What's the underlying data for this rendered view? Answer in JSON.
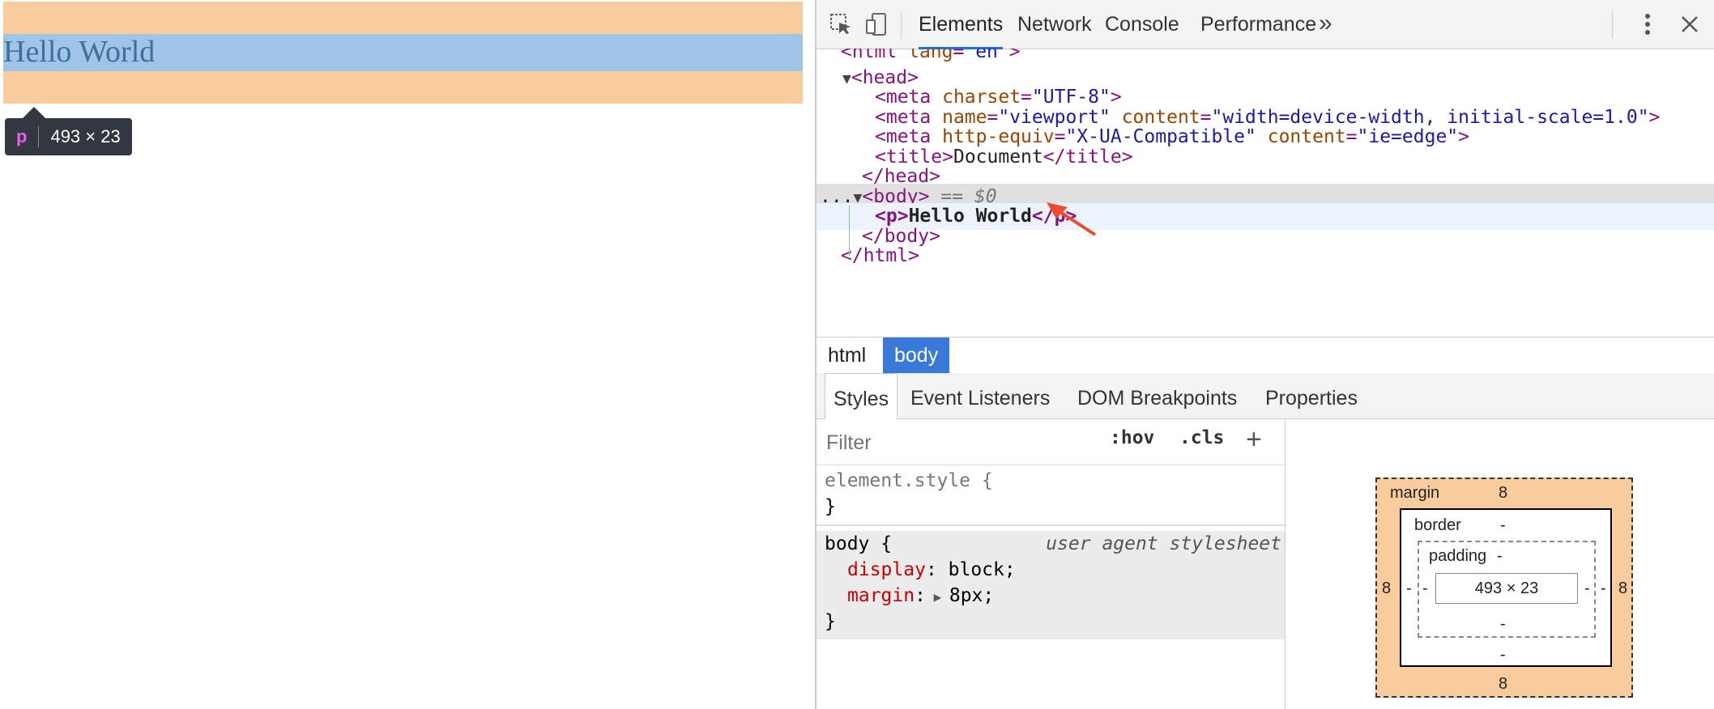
{
  "preview": {
    "paragraph_text": "Hello World",
    "tooltip": {
      "tag": "p",
      "dimensions": "493 × 23"
    }
  },
  "toolbar": {
    "tabs": [
      "Elements",
      "Network",
      "Console",
      "Performance"
    ],
    "active_tab": "Elements",
    "more_tabs": "»"
  },
  "dom": {
    "lines": {
      "html_open": {
        "lt": "<",
        "tag": "html",
        "attr": "lang",
        "eq": "=",
        "val": "\"en\"",
        "gt": ">"
      },
      "head_open": "head",
      "meta1": {
        "tag": "meta",
        "attr": "charset",
        "val": "\"UTF-8\""
      },
      "meta2": {
        "tag": "meta",
        "attr1": "name",
        "val1": "\"viewport\"",
        "attr2": "content",
        "val2": "\"width=device-width, initial-scale=1.0\""
      },
      "meta3": {
        "tag": "meta",
        "attr1": "http-equiv",
        "val1": "\"X-UA-Compatible\"",
        "attr2": "content",
        "val2": "\"ie=edge\""
      },
      "title": {
        "tag": "title",
        "text": "Document"
      },
      "head_close": "head",
      "body_open": {
        "tag": "body",
        "marker": "== $0",
        "ellipsis": "..."
      },
      "p": {
        "tag": "p",
        "text": "Hello World"
      },
      "body_close": "body",
      "html_close": "html"
    }
  },
  "breadcrumbs": [
    "html",
    "body"
  ],
  "subtabs": [
    "Styles",
    "Event Listeners",
    "DOM Breakpoints",
    "Properties"
  ],
  "styles": {
    "filter_placeholder": "Filter",
    "hov": ":hov",
    "cls": ".cls",
    "plus": "+",
    "element_style": "element.style {",
    "close_brace": "}",
    "body_selector": "body {",
    "source": "user agent stylesheet",
    "props": [
      {
        "name": "display",
        "value": "block;"
      },
      {
        "name": "margin",
        "value": "8px;"
      }
    ]
  },
  "boxmodel": {
    "margin_label": "margin",
    "margin_top": "8",
    "margin_bottom": "8",
    "margin_left": "8",
    "margin_right": "8",
    "border_label": "border",
    "border_top": "-",
    "border_bottom": "-",
    "border_left": "-",
    "border_right": "-",
    "padding_label": "padding",
    "padding_top": "-",
    "padding_bottom": "-",
    "padding_left": "-",
    "padding_right": "-",
    "content": "493 × 23"
  },
  "colors": {
    "margin": "#f9cc9d",
    "content": "#9fc4e7",
    "accent": "#1a73e8",
    "tag": "#881280",
    "attr_name": "#994500",
    "attr_value": "#1a1aa6"
  },
  "icons": [
    "inspect-element-icon",
    "device-toolbar-icon",
    "kebab-menu-icon",
    "close-icon",
    "arrow-annotation-icon"
  ]
}
